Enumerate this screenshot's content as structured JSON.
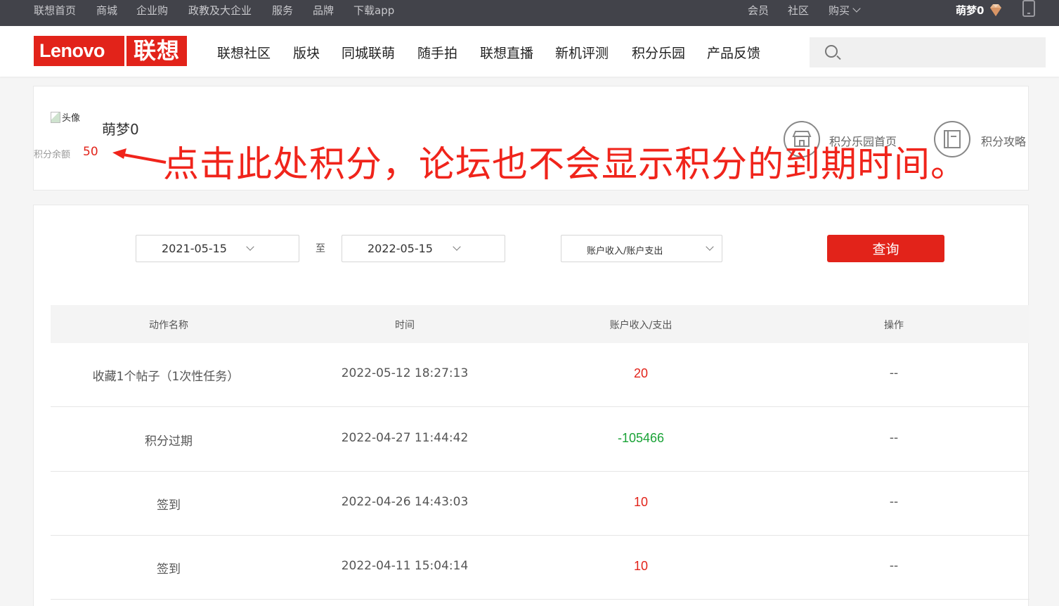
{
  "topbar": {
    "links": [
      "联想首页",
      "商城",
      "企业购",
      "政教及大企业",
      "服务",
      "品牌",
      "下载app"
    ],
    "right_links": [
      "会员",
      "社区",
      "购买"
    ],
    "username": "萌梦0",
    "icons": [
      "diamond-icon",
      "phone-icon",
      "chevron-down-icon"
    ]
  },
  "header": {
    "logo_en": "Lenovo",
    "logo_cn": "联想",
    "nav": [
      "联想社区",
      "版块",
      "同城联萌",
      "随手拍",
      "联想直播",
      "新机评测",
      "积分乐园",
      "产品反馈"
    ],
    "search_placeholder": ""
  },
  "profile": {
    "avatar_alt": "头像",
    "username": "萌梦0",
    "balance_label": "积分余额",
    "balance_value": "50",
    "links": [
      "积分乐园首页",
      "积分攻略"
    ]
  },
  "annotation": {
    "text": "点击此处积分，论坛也不会显示积分的到期时间。",
    "color": "#f0241b"
  },
  "filters": {
    "start_date": "2021-05-15",
    "to_label": "至",
    "end_date": "2022-05-15",
    "type": "账户收入/账户支出",
    "query_label": "查询"
  },
  "table": {
    "headers": [
      "动作名称",
      "时间",
      "账户收入/支出",
      "操作"
    ],
    "rows": [
      {
        "action": "收藏1个帖子（1次性任务）",
        "time": "2022-05-12 18:27:13",
        "amount": "20",
        "op": "--"
      },
      {
        "action": "积分过期",
        "time": "2022-04-27 11:44:42",
        "amount": "-105466",
        "op": "--"
      },
      {
        "action": "签到",
        "time": "2022-04-26 14:43:03",
        "amount": "10",
        "op": "--"
      },
      {
        "action": "签到",
        "time": "2022-04-11 15:04:14",
        "amount": "10",
        "op": "--"
      }
    ]
  },
  "colors": {
    "brand_red": "#e2231a",
    "positive": "#e2231a",
    "negative": "#1aa337",
    "topbar_bg": "#42434a"
  }
}
